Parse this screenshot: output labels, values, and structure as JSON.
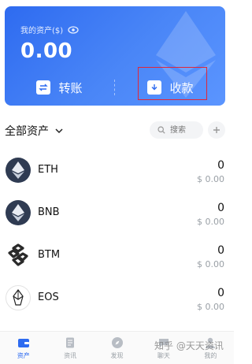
{
  "card": {
    "label": "我的资产($)",
    "value": "0.00",
    "transfer_label": "转账",
    "receive_label": "收款"
  },
  "assets": {
    "title": "全部资产",
    "search_placeholder": "搜索",
    "items": [
      {
        "symbol": "ETH",
        "amount": "0",
        "usd": "$ 0.00",
        "icon": "eth-icon"
      },
      {
        "symbol": "BNB",
        "amount": "0",
        "usd": "$ 0.00",
        "icon": "bnb-icon"
      },
      {
        "symbol": "BTM",
        "amount": "0",
        "usd": "$ 0.00",
        "icon": "btm-icon"
      },
      {
        "symbol": "EOS",
        "amount": "0",
        "usd": "$ 0.00",
        "icon": "eos-icon"
      }
    ]
  },
  "nav": [
    {
      "label": "资产",
      "icon": "wallet-icon",
      "active": true
    },
    {
      "label": "资讯",
      "icon": "news-icon",
      "active": false
    },
    {
      "label": "发现",
      "icon": "compass-icon",
      "active": false
    },
    {
      "label": "聊天",
      "icon": "chat-icon",
      "active": false
    },
    {
      "label": "我的",
      "icon": "user-icon",
      "active": false
    }
  ],
  "watermark": "知乎 @天天资讯",
  "colors": {
    "accent": "#2e6bf0",
    "highlight_box": "#e0263a"
  }
}
